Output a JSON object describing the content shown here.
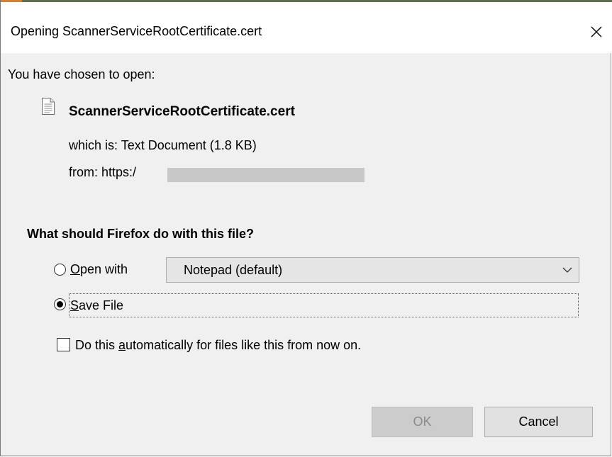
{
  "window": {
    "title": "Opening ScannerServiceRootCertificate.cert",
    "close_icon": "close-icon"
  },
  "file_info": {
    "intro": "You have chosen to open:",
    "file_icon": "text-document-icon",
    "file_name": "ScannerServiceRootCertificate.cert",
    "type_label": "which is:",
    "type_value": "Text Document (1.8 KB)",
    "from_label": "from:",
    "from_value": "https:/"
  },
  "action": {
    "question": "What should Firefox do with this file?",
    "open_with": {
      "label_prefix": "",
      "label_mnemonic": "O",
      "label_rest": "pen with",
      "selected": false
    },
    "app_select": {
      "value": "Notepad (default)",
      "chevron_icon": "chevron-down-icon"
    },
    "save_file": {
      "label_mnemonic": "S",
      "label_rest": "ave File",
      "selected": true
    },
    "auto": {
      "label_prefix": "Do this ",
      "label_mnemonic": "a",
      "label_rest": "utomatically for files like this from now on.",
      "checked": false
    }
  },
  "buttons": {
    "ok_label": "OK",
    "ok_enabled": false,
    "cancel_label": "Cancel"
  }
}
